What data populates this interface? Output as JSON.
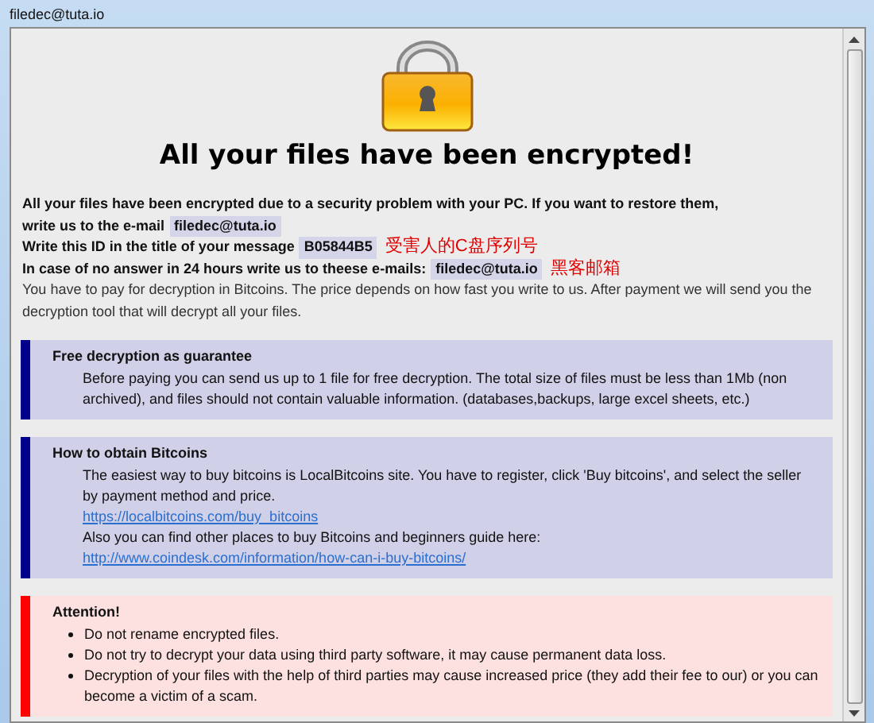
{
  "window": {
    "title": "filedec@tuta.io"
  },
  "heading": "All your files have been encrypted!",
  "intro": {
    "restore_text": "All your files have been encrypted due to a security problem with your PC. If you want to restore them,",
    "email_prompt": "write us to the e-mail",
    "email": "filedec@tuta.io",
    "id_text": "Write this ID in the title of your message",
    "id": "B05844B5",
    "id_note": "受害人的C盘序列号",
    "backup_text": "In case of no answer in 24 hours write us to theese e-mails:",
    "backup_email": "filedec@tuta.io",
    "backup_note": "黑客邮箱",
    "payment_text": "You have to pay for decryption in Bitcoins. The price depends on how fast you write to us. After payment we will send you the decryption tool that will decrypt all your files."
  },
  "sections": [
    {
      "kind": "info",
      "title": "Free decryption as guarantee",
      "items": [
        {
          "kind": "text",
          "text": "Before paying you can send us up to 1 file for free decryption. The total size of files must be less than 1Mb (non archived), and files should not contain valuable information. (databases,backups, large excel sheets, etc.)"
        }
      ]
    },
    {
      "kind": "info",
      "title": "How to obtain Bitcoins",
      "items": [
        {
          "kind": "text",
          "text": "The easiest way to buy bitcoins is LocalBitcoins site. You have to register, click 'Buy bitcoins', and select the seller by payment method and price."
        },
        {
          "kind": "link",
          "text": "https://localbitcoins.com/buy_bitcoins"
        },
        {
          "kind": "text",
          "text": "Also you can find other places to buy Bitcoins and beginners guide here:"
        },
        {
          "kind": "link",
          "text": "http://www.coindesk.com/information/how-can-i-buy-bitcoins/"
        }
      ]
    },
    {
      "kind": "warning",
      "title": "Attention!",
      "items": [
        {
          "kind": "bullet",
          "text": "Do not rename encrypted files."
        },
        {
          "kind": "bullet",
          "text": "Do not try to decrypt your data using third party software, it may cause permanent data loss."
        },
        {
          "kind": "bullet",
          "text": "Decryption of your files with the help of third parties may cause increased price (they add their fee to our) or you can become a victim of a scam."
        }
      ]
    }
  ]
}
